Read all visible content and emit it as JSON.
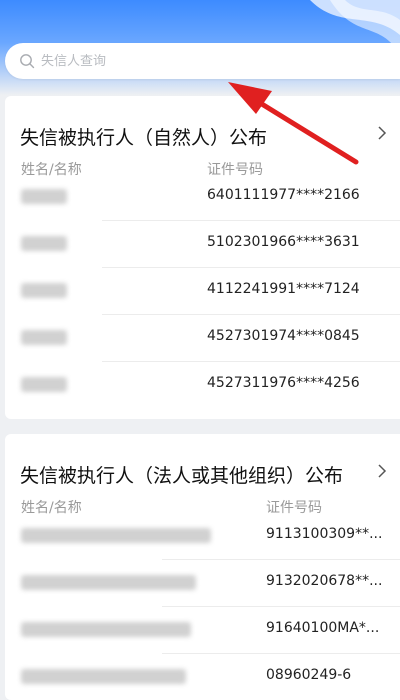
{
  "search": {
    "placeholder": "失信人查询"
  },
  "section_natural": {
    "title": "失信被执行人（自然人）公布",
    "col_name": "姓名/名称",
    "col_id": "证件号码",
    "rows": [
      {
        "id": "6401111977****2166"
      },
      {
        "id": "5102301966****3631"
      },
      {
        "id": "4112241991****7124"
      },
      {
        "id": "4527301974****0845"
      },
      {
        "id": "4527311976****4256"
      }
    ]
  },
  "section_legal": {
    "title": "失信被执行人（法人或其他组织）公布",
    "col_name": "姓名/名称",
    "col_id": "证件号码",
    "rows": [
      {
        "id": "9113100309**..."
      },
      {
        "id": "9132020678**..."
      },
      {
        "id": "91640100MA*..."
      },
      {
        "id": "08960249-6"
      }
    ]
  },
  "colors": {
    "accent": "#3d8bff",
    "arrow": "#e02020"
  },
  "icons": {
    "search": "search-icon",
    "chevron": "chevron-right-icon",
    "annotation": "red-arrow"
  }
}
